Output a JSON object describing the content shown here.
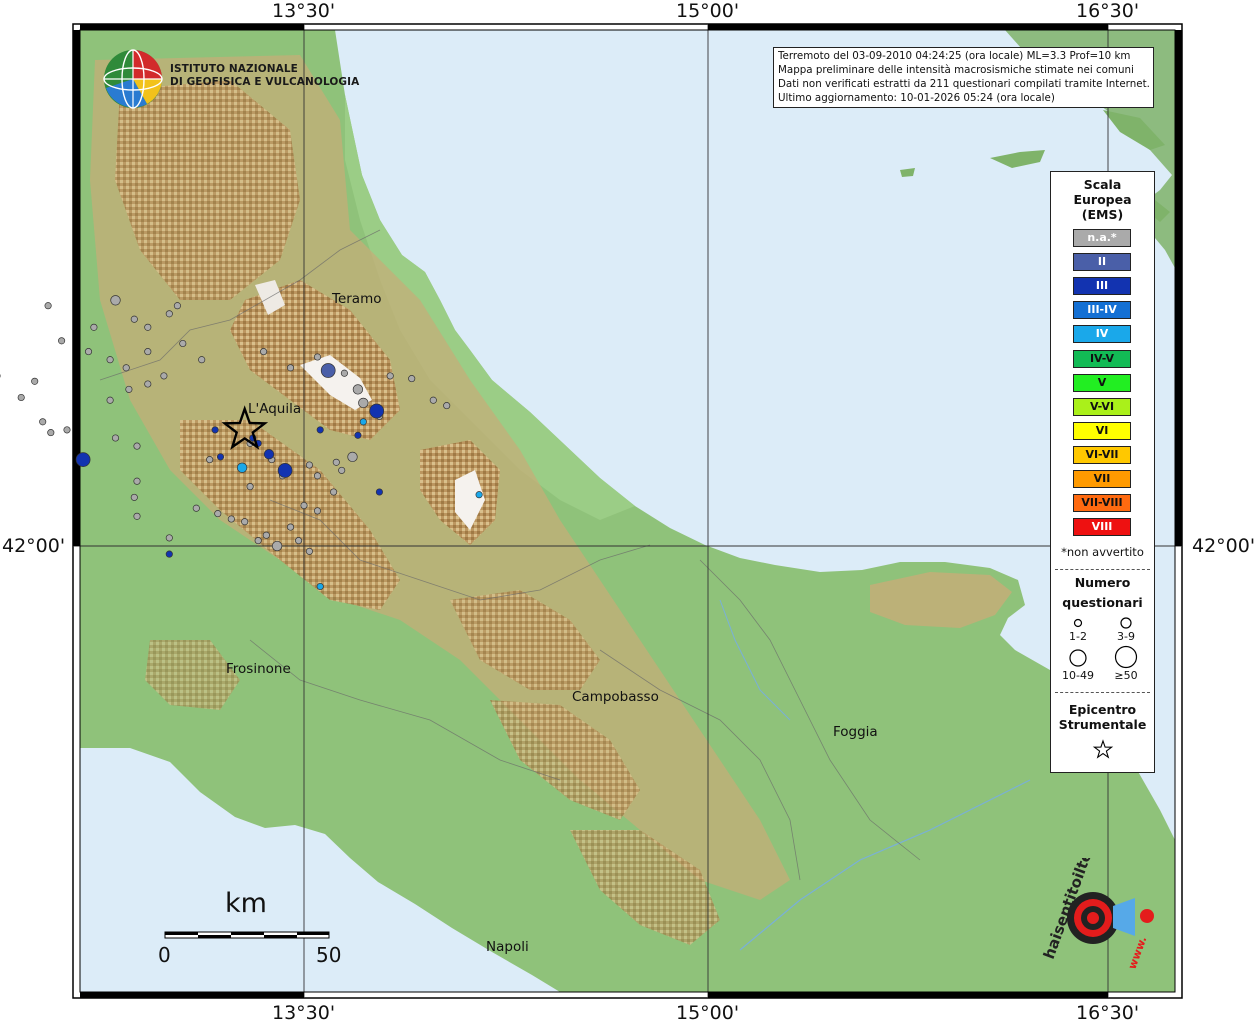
{
  "map": {
    "graticule_top": [
      "13°30'",
      "15°00'",
      "16°30'"
    ],
    "graticule_bottom": [
      "13°30'",
      "15°00'",
      "16°30'"
    ],
    "graticule_left": "42°00'",
    "graticule_right": "42°00'"
  },
  "info_box": {
    "line1": "Terremoto del 03-09-2010 04:24:25 (ora locale) ML=3.3 Prof=10 km",
    "line2": "Mappa preliminare delle intensità macrosismiche stimate nei comuni",
    "line3": "Dati non verificati estratti da 211 questionari compilati tramite Internet.",
    "line4": "Ultimo aggiornamento: 10-01-2026 05:24 (ora locale)"
  },
  "logo_ingv": {
    "line1": "ISTITUTO NAZIONALE",
    "line2": "DI GEOFISICA E VULCANOLOGIA"
  },
  "legend": {
    "scale_title": [
      "Scala",
      "Europea",
      "(EMS)"
    ],
    "ems_items": [
      {
        "label": "n.a.*",
        "color": "#aaaaaa",
        "text_color": "#ffffff"
      },
      {
        "label": "II",
        "color": "#4a5fa8",
        "text_color": "#ffffff"
      },
      {
        "label": "III",
        "color": "#1233b0",
        "text_color": "#ffffff"
      },
      {
        "label": "III-IV",
        "color": "#1470d4",
        "text_color": "#ffffff"
      },
      {
        "label": "IV",
        "color": "#1aa8ea",
        "text_color": "#ffffff"
      },
      {
        "label": "IV-V",
        "color": "#12bb55",
        "text_color": "#111111"
      },
      {
        "label": "V",
        "color": "#22ee22",
        "text_color": "#111111"
      },
      {
        "label": "V-VI",
        "color": "#aaf01a",
        "text_color": "#111111"
      },
      {
        "label": "VI",
        "color": "#ffff00",
        "text_color": "#111111"
      },
      {
        "label": "VI-VII",
        "color": "#ffc800",
        "text_color": "#111111"
      },
      {
        "label": "VII",
        "color": "#ff9a00",
        "text_color": "#111111"
      },
      {
        "label": "VII-VIII",
        "color": "#ff6a10",
        "text_color": "#111111"
      },
      {
        "label": "VIII",
        "color": "#ee1111",
        "text_color": "#ffffff"
      }
    ],
    "not_felt_note": "*non avvertito",
    "count_title": [
      "Numero",
      "questionari"
    ],
    "count_classes": [
      "1-2",
      "3-9",
      "10-49",
      "≥50"
    ],
    "epicenter_title": [
      "Epicentro",
      "Strumentale"
    ]
  },
  "cities": [
    {
      "name": "Teramo"
    },
    {
      "name": "L'Aquila"
    },
    {
      "name": "Frosinone"
    },
    {
      "name": "Campobasso"
    },
    {
      "name": "Foggia"
    },
    {
      "name": "Napoli"
    }
  ],
  "scale_bar": {
    "unit": "km",
    "start": "0",
    "end": "50"
  },
  "logo_hsit": {
    "text": "haisentitoilterremoto.it",
    "www": "www."
  },
  "colors": {
    "sea": "#dcecf8",
    "lowland": "#8fc27a",
    "upland": "#c9b27a",
    "mountain": "#b08a55",
    "foreign_coast": "#7fb36a"
  },
  "intensity_points": [
    {
      "lon": 12.55,
      "lat": 42.89,
      "cls": "na",
      "n": "1-2"
    },
    {
      "lon": 12.8,
      "lat": 42.91,
      "cls": "na",
      "n": "3-9"
    },
    {
      "lon": 12.87,
      "lat": 42.84,
      "cls": "na",
      "n": "1-2"
    },
    {
      "lon": 12.92,
      "lat": 42.81,
      "cls": "na",
      "n": "1-2"
    },
    {
      "lon": 13.0,
      "lat": 42.86,
      "cls": "na",
      "n": "1-2"
    },
    {
      "lon": 13.03,
      "lat": 42.89,
      "cls": "na",
      "n": "1-2"
    },
    {
      "lon": 12.72,
      "lat": 42.81,
      "cls": "na",
      "n": "1-2"
    },
    {
      "lon": 12.6,
      "lat": 42.76,
      "cls": "na",
      "n": "1-2"
    },
    {
      "lon": 12.7,
      "lat": 42.72,
      "cls": "na",
      "n": "1-2"
    },
    {
      "lon": 12.78,
      "lat": 42.69,
      "cls": "na",
      "n": "1-2"
    },
    {
      "lon": 12.92,
      "lat": 42.72,
      "cls": "na",
      "n": "1-2"
    },
    {
      "lon": 12.36,
      "lat": 42.63,
      "cls": "na",
      "n": "1-2"
    },
    {
      "lon": 12.5,
      "lat": 42.61,
      "cls": "na",
      "n": "1-2"
    },
    {
      "lon": 12.85,
      "lat": 42.58,
      "cls": "na",
      "n": "1-2"
    },
    {
      "lon": 12.92,
      "lat": 42.6,
      "cls": "na",
      "n": "1-2"
    },
    {
      "lon": 12.45,
      "lat": 42.55,
      "cls": "na",
      "n": "1-2"
    },
    {
      "lon": 12.53,
      "lat": 42.46,
      "cls": "na",
      "n": "1-2"
    },
    {
      "lon": 12.56,
      "lat": 42.42,
      "cls": "na",
      "n": "1-2"
    },
    {
      "lon": 12.8,
      "lat": 42.4,
      "cls": "na",
      "n": "1-2"
    },
    {
      "lon": 12.88,
      "lat": 42.37,
      "cls": "na",
      "n": "1-2"
    },
    {
      "lon": 13.35,
      "lat": 42.72,
      "cls": "na",
      "n": "1-2"
    },
    {
      "lon": 13.45,
      "lat": 42.66,
      "cls": "na",
      "n": "1-2"
    },
    {
      "lon": 13.55,
      "lat": 42.7,
      "cls": "na",
      "n": "1-2"
    },
    {
      "lon": 13.65,
      "lat": 42.64,
      "cls": "na",
      "n": "1-2"
    },
    {
      "lon": 13.7,
      "lat": 42.58,
      "cls": "na",
      "n": "3-9"
    },
    {
      "lon": 13.72,
      "lat": 42.53,
      "cls": "na",
      "n": "3-9"
    },
    {
      "lon": 13.78,
      "lat": 42.48,
      "cls": "na",
      "n": "1-2"
    },
    {
      "lon": 13.82,
      "lat": 42.63,
      "cls": "na",
      "n": "1-2"
    },
    {
      "lon": 13.9,
      "lat": 42.62,
      "cls": "na",
      "n": "1-2"
    },
    {
      "lon": 13.98,
      "lat": 42.54,
      "cls": "na",
      "n": "1-2"
    },
    {
      "lon": 13.68,
      "lat": 42.33,
      "cls": "na",
      "n": "3-9"
    },
    {
      "lon": 13.64,
      "lat": 42.28,
      "cls": "na",
      "n": "1-2"
    },
    {
      "lon": 13.55,
      "lat": 42.26,
      "cls": "na",
      "n": "1-2"
    },
    {
      "lon": 13.61,
      "lat": 42.2,
      "cls": "na",
      "n": "1-2"
    },
    {
      "lon": 13.5,
      "lat": 42.15,
      "cls": "na",
      "n": "1-2"
    },
    {
      "lon": 13.55,
      "lat": 42.13,
      "cls": "na",
      "n": "1-2"
    },
    {
      "lon": 13.45,
      "lat": 42.07,
      "cls": "na",
      "n": "1-2"
    },
    {
      "lon": 13.36,
      "lat": 42.04,
      "cls": "na",
      "n": "1-2"
    },
    {
      "lon": 13.4,
      "lat": 42.0,
      "cls": "na",
      "n": "3-9"
    },
    {
      "lon": 13.48,
      "lat": 42.02,
      "cls": "na",
      "n": "1-2"
    },
    {
      "lon": 13.23,
      "lat": 42.1,
      "cls": "na",
      "n": "1-2"
    },
    {
      "lon": 13.28,
      "lat": 42.09,
      "cls": "na",
      "n": "1-2"
    },
    {
      "lon": 13.33,
      "lat": 42.02,
      "cls": "na",
      "n": "1-2"
    },
    {
      "lon": 13.18,
      "lat": 42.12,
      "cls": "na",
      "n": "1-2"
    },
    {
      "lon": 13.1,
      "lat": 42.14,
      "cls": "na",
      "n": "1-2"
    },
    {
      "lon": 13.0,
      "lat": 42.03,
      "cls": "na",
      "n": "1-2"
    },
    {
      "lon": 12.88,
      "lat": 42.11,
      "cls": "na",
      "n": "1-2"
    },
    {
      "lon": 12.88,
      "lat": 42.24,
      "cls": "na",
      "n": "1-2"
    },
    {
      "lon": 12.87,
      "lat": 42.18,
      "cls": "na",
      "n": "1-2"
    },
    {
      "lon": 13.3,
      "lat": 42.22,
      "cls": "na",
      "n": "1-2"
    },
    {
      "lon": 13.15,
      "lat": 42.32,
      "cls": "na",
      "n": "1-2"
    },
    {
      "lon": 13.3,
      "lat": 42.38,
      "cls": "na",
      "n": "1-2"
    },
    {
      "lon": 13.42,
      "lat": 42.26,
      "cls": "na",
      "n": "1-2"
    },
    {
      "lon": 13.38,
      "lat": 42.32,
      "cls": "na",
      "n": "1-2"
    },
    {
      "lon": 13.52,
      "lat": 41.98,
      "cls": "na",
      "n": "1-2"
    },
    {
      "lon": 14.03,
      "lat": 42.52,
      "cls": "na",
      "n": "1-2"
    },
    {
      "lon": 12.62,
      "lat": 42.43,
      "cls": "na",
      "n": "1-2"
    },
    {
      "lon": 12.78,
      "lat": 42.54,
      "cls": "na",
      "n": "1-2"
    },
    {
      "lon": 12.84,
      "lat": 42.66,
      "cls": "na",
      "n": "1-2"
    },
    {
      "lon": 12.98,
      "lat": 42.63,
      "cls": "na",
      "n": "1-2"
    },
    {
      "lon": 13.05,
      "lat": 42.75,
      "cls": "na",
      "n": "1-2"
    },
    {
      "lon": 13.12,
      "lat": 42.69,
      "cls": "na",
      "n": "1-2"
    },
    {
      "lon": 13.62,
      "lat": 42.31,
      "cls": "na",
      "n": "1-2"
    },
    {
      "lon": 13.52,
      "lat": 42.3,
      "cls": "na",
      "n": "1-2"
    },
    {
      "lon": 13.59,
      "lat": 42.65,
      "cls": "II",
      "n": "10-49"
    },
    {
      "lon": 12.68,
      "lat": 42.32,
      "cls": "III",
      "n": "10-49"
    },
    {
      "lon": 13.37,
      "lat": 42.34,
      "cls": "III",
      "n": "3-9"
    },
    {
      "lon": 13.43,
      "lat": 42.28,
      "cls": "III",
      "n": "10-49"
    },
    {
      "lon": 13.77,
      "lat": 42.5,
      "cls": "III",
      "n": "10-49"
    },
    {
      "lon": 13.33,
      "lat": 42.38,
      "cls": "III",
      "n": "1-2"
    },
    {
      "lon": 13.17,
      "lat": 42.43,
      "cls": "III",
      "n": "1-2"
    },
    {
      "lon": 13.19,
      "lat": 42.33,
      "cls": "III",
      "n": "1-2"
    },
    {
      "lon": 13.31,
      "lat": 42.4,
      "cls": "III",
      "n": "1-2"
    },
    {
      "lon": 13.56,
      "lat": 42.43,
      "cls": "III",
      "n": "1-2"
    },
    {
      "lon": 13.7,
      "lat": 42.41,
      "cls": "III",
      "n": "1-2"
    },
    {
      "lon": 13.78,
      "lat": 42.2,
      "cls": "III",
      "n": "1-2"
    },
    {
      "lon": 13.0,
      "lat": 41.97,
      "cls": "III",
      "n": "1-2"
    },
    {
      "lon": 13.72,
      "lat": 42.46,
      "cls": "IV",
      "n": "1-2"
    },
    {
      "lon": 13.27,
      "lat": 42.29,
      "cls": "IV",
      "n": "3-9"
    },
    {
      "lon": 14.15,
      "lat": 42.19,
      "cls": "IV",
      "n": "1-2"
    },
    {
      "lon": 13.56,
      "lat": 41.85,
      "cls": "IV",
      "n": "1-2"
    }
  ],
  "epicenter": {
    "lon": 13.28,
    "lat": 42.43
  }
}
